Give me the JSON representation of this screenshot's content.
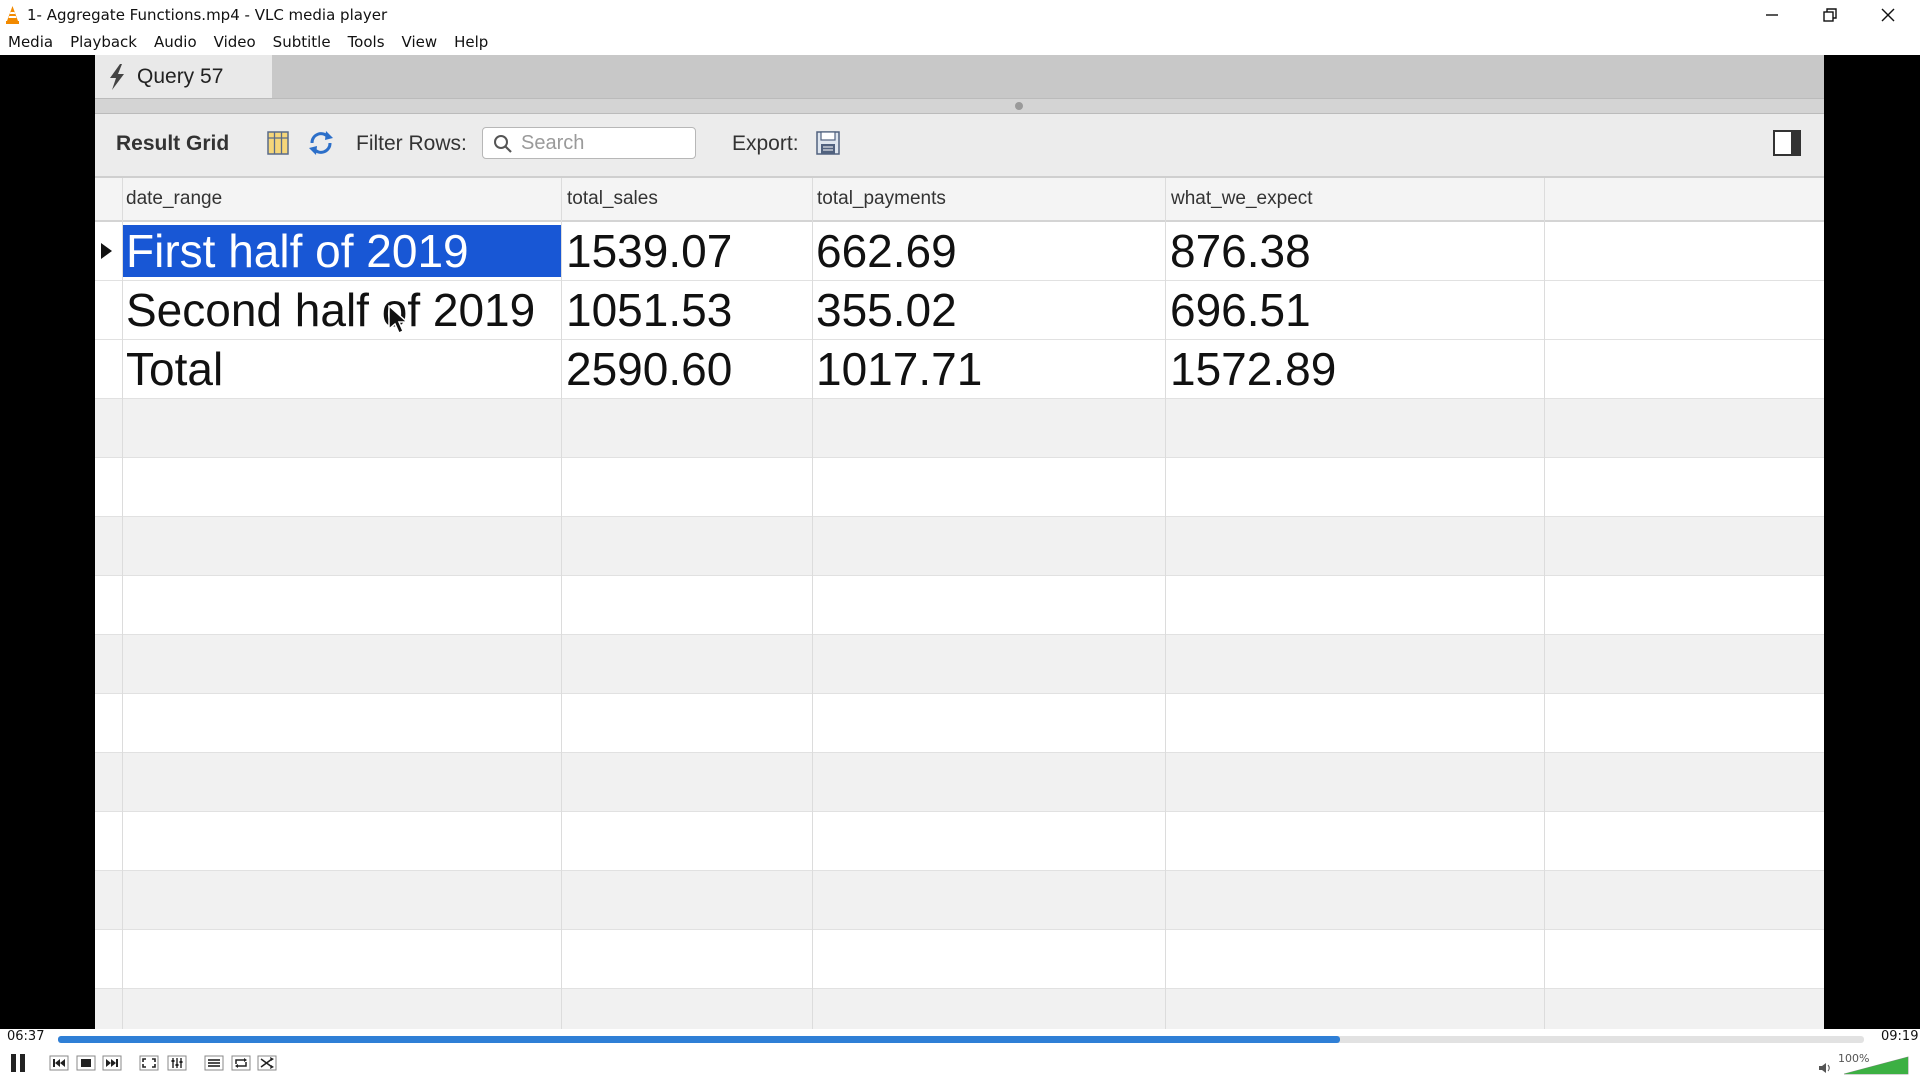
{
  "window": {
    "title": "1- Aggregate Functions.mp4 - VLC media player"
  },
  "menu": [
    "Media",
    "Playback",
    "Audio",
    "Video",
    "Subtitle",
    "Tools",
    "View",
    "Help"
  ],
  "video_content": {
    "tab": {
      "label": "Query 57",
      "icon": "lightning-icon"
    },
    "toolbar": {
      "result_grid_label": "Result Grid",
      "filter_rows_label": "Filter Rows:",
      "search_placeholder": "Search",
      "export_label": "Export:"
    },
    "grid": {
      "columns": [
        "date_range",
        "total_sales",
        "total_payments",
        "what_we_expect"
      ],
      "rows": [
        [
          "First half of 2019",
          "1539.07",
          "662.69",
          "876.38"
        ],
        [
          "Second half of 2019",
          "1051.53",
          "355.02",
          "696.51"
        ],
        [
          "Total",
          "2590.60",
          "1017.71",
          "1572.89"
        ]
      ],
      "selected_row": 0,
      "selection_color": "#1857d5"
    }
  },
  "player": {
    "elapsed": "06:37",
    "duration": "09:19",
    "progress_fraction": 0.71,
    "volume_label": "100%",
    "volume_fraction": 1.0,
    "accent_color": "#2f7fd6",
    "volume_color": "#3cb043"
  }
}
